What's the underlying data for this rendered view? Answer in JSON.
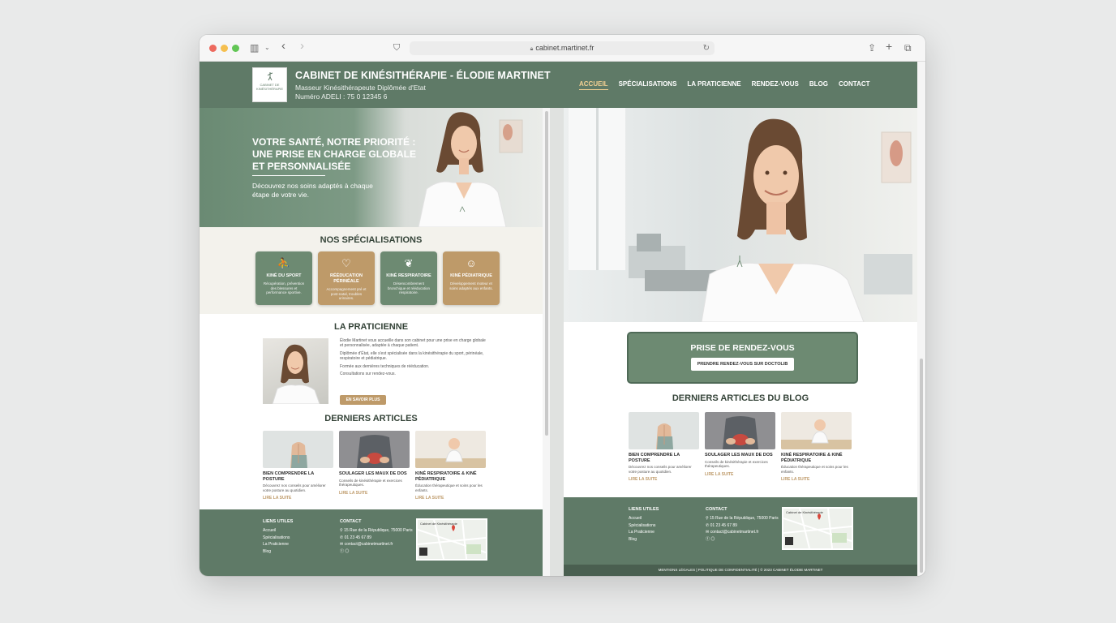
{
  "browser": {
    "url": "cabinet.martinet.fr",
    "toolbar_icons": {
      "sidebar": "sidebar-icon",
      "back": "back-icon",
      "forward": "forward-icon",
      "share": "share-icon",
      "new_tab": "plus-icon",
      "tabs": "tabs-icon"
    }
  },
  "header": {
    "logo_text": "CABINET DE KINÉSITHÉRAPIE",
    "title": "CABINET DE KINÉSITHÉRAPIE - ÉLODIE MARTINET",
    "subtitle": "Masseur Kinésithérapeute Diplômée d'Etat",
    "adeli": "Numéro ADELI : 75 0 12345 6",
    "nav": [
      "ACCUEIL",
      "SPÉCIALISATIONS",
      "LA PRATICIENNE",
      "RENDEZ-VOUS",
      "BLOG",
      "CONTACT"
    ],
    "active_nav": "ACCUEIL"
  },
  "hero": {
    "title": "VOTRE SANTÉ, NOTRE PRIORITÉ : UNE PRISE EN CHARGE GLOBALE ET PERSONNALISÉE",
    "text": "Découvrez nos soins adaptés à chaque étape de votre vie."
  },
  "specialisations": {
    "title": "NOS SPÉCIALISATIONS",
    "cards": [
      {
        "name": "KINÉ DU SPORT",
        "desc": "Récupération, prévention des blessures et performance sportive.",
        "icon": "runner-icon",
        "color": "#6d8a72"
      },
      {
        "name": "RÉÉDUCATION PÉRINÉALE",
        "desc": "Accompagnement pré et post-natal, troubles urinaires.",
        "icon": "pelvis-icon",
        "color": "#be9a69"
      },
      {
        "name": "KINÉ RESPIRATOIRE",
        "desc": "Désencombrement bronchique et rééducation respiratoire.",
        "icon": "lungs-icon",
        "color": "#6d8a72"
      },
      {
        "name": "KINÉ PÉDIATRIQUE",
        "desc": "Développement moteur et soins adaptés aux enfants.",
        "icon": "child-icon",
        "color": "#be9a69"
      }
    ]
  },
  "praticienne": {
    "title": "LA PRATICIENNE",
    "paragraphs": [
      "Élodie Martinet vous accueille dans son cabinet pour une prise en charge globale et personnalisée, adaptée à chaque patient.",
      "Diplômée d'État, elle s'est spécialisée dans la kinésithérapie du sport, périnéale, respiratoire et pédiatrique.",
      "Formée aux dernières techniques de rééducation.",
      "Consultations sur rendez-vous."
    ],
    "button": "EN SAVOIR PLUS"
  },
  "articles": {
    "title_left": "DERNIERS ARTICLES",
    "title_right": "DERNIERS ARTICLES DU BLOG",
    "items": [
      {
        "title": "BIEN COMPRENDRE LA POSTURE",
        "desc": "Découvrez nos conseils pour améliorer votre posture au quotidien.",
        "link": "LIRE LA SUITE",
        "image": "posture-photo"
      },
      {
        "title": "SOULAGER LES MAUX DE DOS",
        "desc": "Conseils de kinésithérapie et exercices thérapeutiques.",
        "link": "LIRE LA SUITE",
        "image": "back-pain-photo"
      },
      {
        "title": "KINÉ RESPIRATOIRE & KINÉ PÉDIATRIQUE",
        "desc": "Éducation thérapeutique et soins pour les enfants.",
        "link": "LIRE LA SUITE",
        "image": "baby-photo"
      }
    ]
  },
  "rendezvous": {
    "title": "PRISE DE RENDEZ-VOUS",
    "button": "PRENDRE RENDEZ-VOUS SUR DOCTOLIB"
  },
  "footer": {
    "links_title": "LIENS UTILES",
    "links": [
      "Accueil",
      "Spécialisations",
      "La Praticienne",
      "Blog"
    ],
    "contact_title": "CONTACT",
    "address": "15 Rue de la République, 75000 Paris",
    "phone": "01 23 45 67 89",
    "email": "contact@cabinetmartinet.fr",
    "social": [
      "facebook-icon",
      "instagram-icon"
    ],
    "map_label": "Cabinet de Kinésithérapie",
    "legal": "MENTIONS LÉGALES | POLITIQUE DE CONFIDENTIALITÉ | © 2023 CABINET ÉLODIE MARTINET"
  },
  "colors": {
    "primary": "#5f7a67",
    "accent": "#be9a69",
    "active_nav": "#f1cf92"
  }
}
